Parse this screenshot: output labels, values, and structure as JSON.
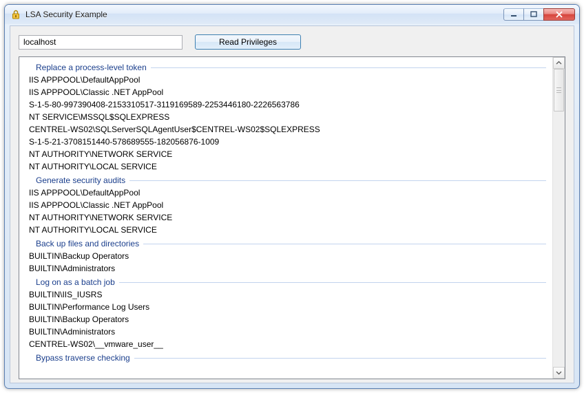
{
  "window": {
    "title": "LSA Security Example"
  },
  "controls": {
    "host_value": "localhost",
    "read_button": "Read Privileges"
  },
  "privileges": [
    {
      "header": "Replace a process-level token",
      "items": [
        "IIS APPPOOL\\DefaultAppPool",
        "IIS APPPOOL\\Classic .NET AppPool",
        "S-1-5-80-997390408-2153310517-3119169589-2253446180-2226563786",
        "NT SERVICE\\MSSQL$SQLEXPRESS",
        "CENTREL-WS02\\SQLServerSQLAgentUser$CENTREL-WS02$SQLEXPRESS",
        "S-1-5-21-3708151440-578689555-182056876-1009",
        "NT AUTHORITY\\NETWORK SERVICE",
        "NT AUTHORITY\\LOCAL SERVICE"
      ]
    },
    {
      "header": "Generate security audits",
      "items": [
        "IIS APPPOOL\\DefaultAppPool",
        "IIS APPPOOL\\Classic .NET AppPool",
        "NT AUTHORITY\\NETWORK SERVICE",
        "NT AUTHORITY\\LOCAL SERVICE"
      ]
    },
    {
      "header": "Back up files and directories",
      "items": [
        "BUILTIN\\Backup Operators",
        "BUILTIN\\Administrators"
      ]
    },
    {
      "header": "Log on as a batch job",
      "items": [
        "BUILTIN\\IIS_IUSRS",
        "BUILTIN\\Performance Log Users",
        "BUILTIN\\Backup Operators",
        "BUILTIN\\Administrators",
        "CENTREL-WS02\\__vmware_user__"
      ]
    }
  ],
  "clipped_next_header": "Bypass traverse checking"
}
